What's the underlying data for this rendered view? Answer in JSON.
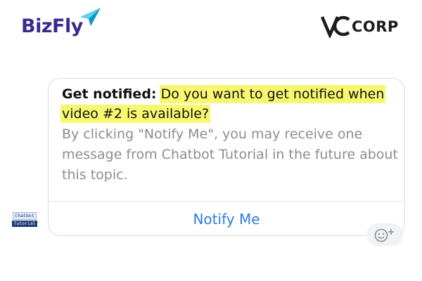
{
  "brand": {
    "bizfly": "BizFly",
    "vccorp_mark": "VC",
    "vccorp_text": "CORP"
  },
  "sender": {
    "avatar_line1": "Chatbot",
    "avatar_line2": "Tutorial"
  },
  "message": {
    "label": "Get notified:",
    "question": "Do you want to get notified when video #2 is available?",
    "description": "By clicking \"Notify Me\", you may receive one message from Chatbot Tutorial in the future about this topic.",
    "button_label": "Notify Me"
  },
  "icons": {
    "logo": "paper-plane-icon",
    "reaction": "add-reaction-icon"
  },
  "colors": {
    "bizfly_brand": "#3a2a8f",
    "highlight": "#f8f870",
    "link_blue": "#2d7ae0",
    "muted_text": "#8a8d91"
  }
}
